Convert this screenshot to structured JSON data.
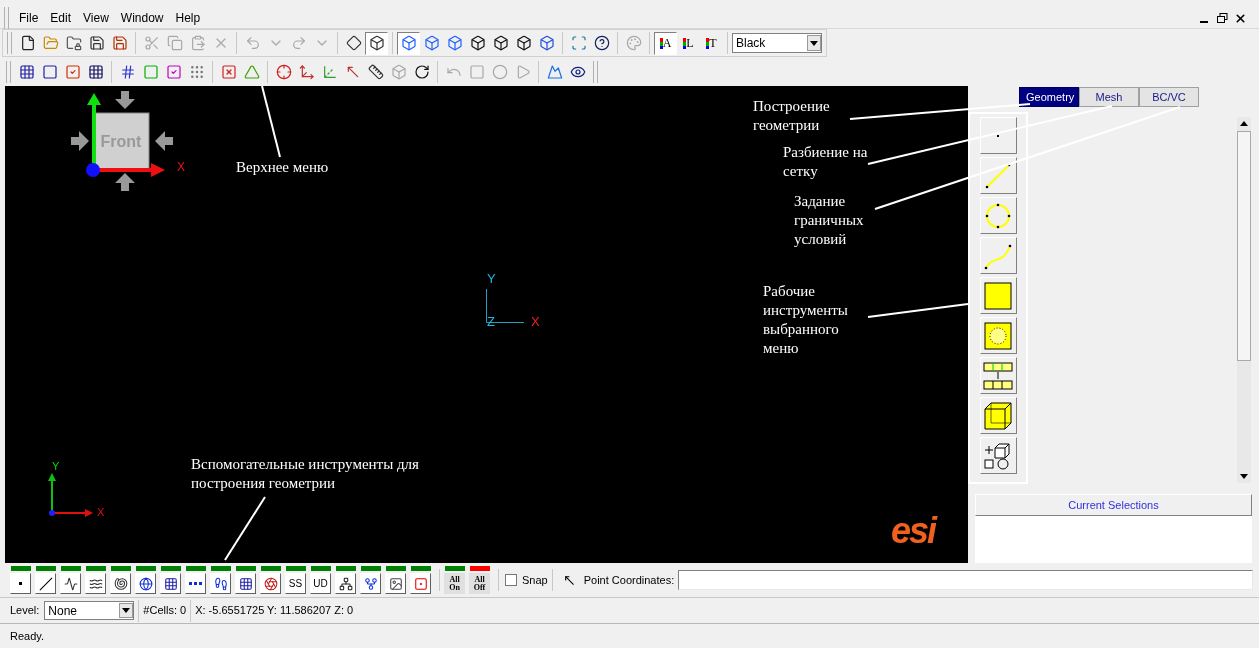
{
  "menu": [
    "File",
    "Edit",
    "View",
    "Window",
    "Help"
  ],
  "toolbar_1": [
    {
      "buttons": [
        {
          "kind": "document",
          "disabled": false,
          "on": false
        },
        {
          "kind": "folder",
          "disabled": false,
          "on": false
        },
        {
          "kind": "folder-lock",
          "disabled": false,
          "on": false
        },
        {
          "kind": "save",
          "disabled": false,
          "on": false
        },
        {
          "kind": "save-color",
          "disabled": false,
          "on": false
        }
      ]
    },
    {
      "buttons": [
        {
          "kind": "scissors",
          "disabled": true,
          "on": false
        },
        {
          "kind": "copy",
          "disabled": true,
          "on": false
        },
        {
          "kind": "paste",
          "disabled": true,
          "on": false
        },
        {
          "kind": "delete",
          "disabled": true,
          "on": false
        }
      ]
    },
    {
      "buttons": [
        {
          "kind": "undo",
          "disabled": true,
          "on": false
        },
        {
          "kind": "caret",
          "disabled": true,
          "on": false
        },
        {
          "kind": "redo",
          "disabled": true,
          "on": false
        },
        {
          "kind": "caret",
          "disabled": true,
          "on": false
        }
      ]
    },
    {
      "buttons": [
        {
          "kind": "shaded-view",
          "disabled": false,
          "on": false
        },
        {
          "kind": "wire-view",
          "disabled": false,
          "on": true
        }
      ]
    },
    {
      "buttons": [
        {
          "kind": "cube-blue",
          "disabled": false,
          "on": true
        },
        {
          "kind": "cube-blue",
          "disabled": false,
          "on": false
        },
        {
          "kind": "cube-blue",
          "disabled": false,
          "on": false
        },
        {
          "kind": "cube",
          "disabled": false,
          "on": false
        },
        {
          "kind": "cube",
          "disabled": false,
          "on": false
        },
        {
          "kind": "cube",
          "disabled": false,
          "on": false
        },
        {
          "kind": "cube-shaded",
          "disabled": false,
          "on": false
        }
      ]
    },
    {
      "buttons": [
        {
          "kind": "fit",
          "disabled": false,
          "on": false
        },
        {
          "kind": "help",
          "disabled": false,
          "on": false
        }
      ]
    },
    {
      "buttons": [
        {
          "kind": "palette",
          "disabled": true,
          "on": false
        }
      ]
    },
    {
      "buttons": [
        {
          "kind": "color-letter",
          "label": "A",
          "disabled": false,
          "on": true
        },
        {
          "kind": "color-letter",
          "label": "L",
          "disabled": false,
          "on": false
        },
        {
          "kind": "color-letter",
          "label": "T",
          "disabled": false,
          "on": false
        }
      ]
    }
  ],
  "color_select": {
    "value": "Black"
  },
  "toolbar_2": [
    {
      "buttons": [
        {
          "kind": "grid",
          "disabled": false
        },
        {
          "kind": "outline",
          "disabled": false
        },
        {
          "kind": "check-grid",
          "disabled": false
        },
        {
          "kind": "grid-dark",
          "disabled": false
        }
      ]
    },
    {
      "buttons": [
        {
          "kind": "hatch",
          "disabled": false
        },
        {
          "kind": "green-square",
          "disabled": false
        },
        {
          "kind": "check-square",
          "disabled": false
        },
        {
          "kind": "dot-grid",
          "disabled": false
        }
      ]
    },
    {
      "buttons": [
        {
          "kind": "x-grid",
          "disabled": false
        },
        {
          "kind": "green-shape",
          "disabled": false
        }
      ]
    },
    {
      "buttons": [
        {
          "kind": "axes-red",
          "disabled": false
        },
        {
          "kind": "axes-cross",
          "disabled": false
        },
        {
          "kind": "axes-green",
          "disabled": false
        },
        {
          "kind": "axes-pointer",
          "disabled": false
        },
        {
          "kind": "ruler",
          "disabled": false
        },
        {
          "kind": "box",
          "disabled": true
        },
        {
          "kind": "rotate",
          "disabled": false
        }
      ]
    },
    {
      "buttons": [
        {
          "kind": "undo-arc",
          "disabled": true
        },
        {
          "kind": "square",
          "disabled": true
        },
        {
          "kind": "circle",
          "disabled": true
        },
        {
          "kind": "play",
          "disabled": true
        }
      ]
    },
    {
      "buttons": [
        {
          "kind": "blue-shape",
          "disabled": false
        },
        {
          "kind": "eye",
          "disabled": false
        }
      ]
    }
  ],
  "viewport": {
    "nav_cube": {
      "face": "Front",
      "x_label": "X"
    },
    "center_axes": {
      "y": "Y",
      "z": "Z",
      "x": "X"
    },
    "corner_axes": {
      "y": "Y",
      "x": "X"
    },
    "logo": "esi",
    "annotations": [
      {
        "text": "Построение геометрии"
      },
      {
        "text": "Разбиение на сетку"
      },
      {
        "text": "Задание граничных условий"
      },
      {
        "text": "Рабочие инструменты выбранного меню"
      },
      {
        "text": "Верхнее меню"
      },
      {
        "text": "Вспомогательные инструменты для построения геометрии"
      }
    ]
  },
  "panel": {
    "tabs": [
      {
        "label": "Geometry",
        "selected": true
      },
      {
        "label": "Mesh",
        "selected": false
      },
      {
        "label": "BC/VC",
        "selected": false
      }
    ],
    "tools": [
      {
        "kind": "point"
      },
      {
        "kind": "line"
      },
      {
        "kind": "circle"
      },
      {
        "kind": "spline"
      },
      {
        "kind": "square"
      },
      {
        "kind": "square-hole"
      },
      {
        "kind": "split"
      },
      {
        "kind": "cube"
      },
      {
        "kind": "transform"
      }
    ],
    "current_selections": "Current Selections"
  },
  "bottom_toolbar": [
    {
      "kind": "point",
      "color": "#008000"
    },
    {
      "kind": "line",
      "color": "#008000"
    },
    {
      "kind": "wave",
      "color": "#008000"
    },
    {
      "kind": "patch",
      "color": "#008000"
    },
    {
      "kind": "patch-hole",
      "color": "#008000"
    },
    {
      "kind": "sphere",
      "color": "#008000"
    },
    {
      "kind": "grid",
      "color": "#008000"
    },
    {
      "kind": "dots",
      "color": "#008000"
    },
    {
      "kind": "steps",
      "color": "#008000"
    },
    {
      "kind": "grid",
      "color": "#008000"
    },
    {
      "kind": "mesh-ball",
      "color": "#008000"
    },
    {
      "label": "SS",
      "color": "#008000"
    },
    {
      "label": "UD",
      "color": "#008000"
    },
    {
      "kind": "tree",
      "color": "#008000"
    },
    {
      "kind": "branch",
      "color": "#008000"
    },
    {
      "kind": "image",
      "color": "#008000"
    },
    {
      "kind": "red-grid",
      "color": "#008000"
    }
  ],
  "all_buttons": [
    {
      "label": "All On",
      "color": "#008000"
    },
    {
      "label": "All Off",
      "color": "#ff0000"
    }
  ],
  "snap": {
    "label": "Snap",
    "checked": false
  },
  "point_coordinates": {
    "label": "Point Coordinates:"
  },
  "level": {
    "label": "Level:",
    "value": "None"
  },
  "cells": "#Cells: 0",
  "coordinates": "X: -5.6551725 Y: 11.586207 Z: 0",
  "status": "Ready."
}
